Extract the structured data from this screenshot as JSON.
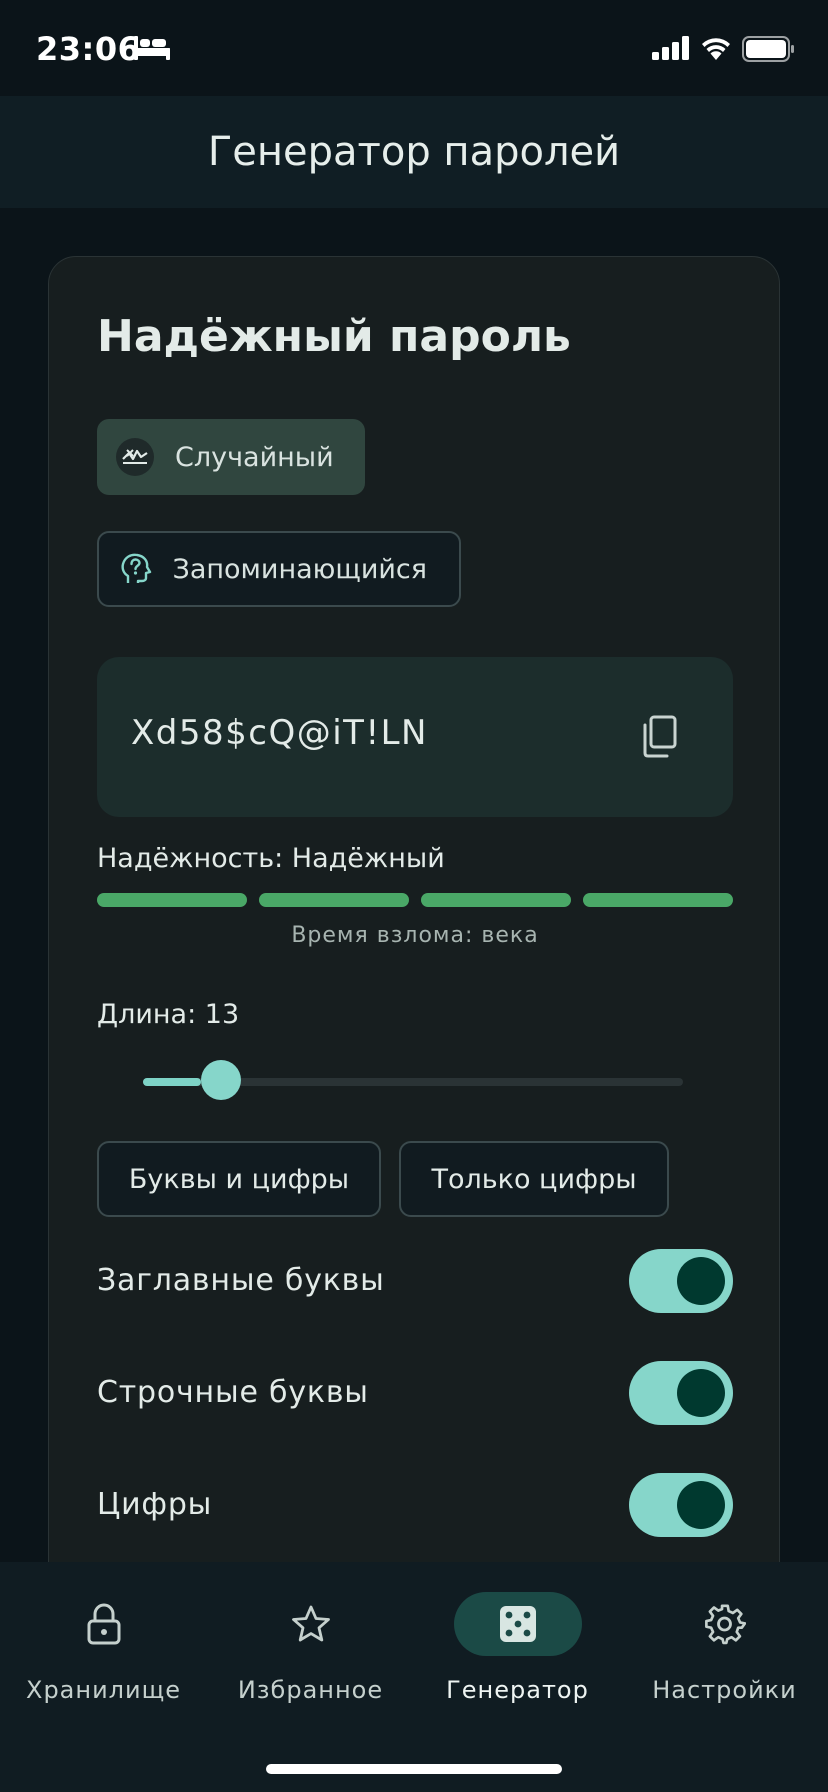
{
  "status_bar": {
    "time": "23:06"
  },
  "header": {
    "title": "Генератор паролей"
  },
  "card": {
    "title": "Надёжный пароль",
    "modes": [
      {
        "label": "Случайный",
        "selected": true
      },
      {
        "label": "Запоминающийся",
        "selected": false
      }
    ],
    "password": "Xd58$cQ@iT!LN",
    "strength": {
      "label": "Надёжность: Надёжный",
      "level": 4,
      "max": 4,
      "crack_time": "Время взлома: века"
    },
    "length": {
      "label": "Длина: 13",
      "value": 13,
      "min": 8,
      "max": 64
    },
    "presets": [
      "Буквы и цифры",
      "Только цифры"
    ],
    "toggles": [
      {
        "label": "Заглавные буквы",
        "on": true
      },
      {
        "label": "Строчные буквы",
        "on": true
      },
      {
        "label": "Цифры",
        "on": true
      }
    ]
  },
  "nav": {
    "items": [
      {
        "label": "Хранилище",
        "icon": "lock-icon",
        "active": false
      },
      {
        "label": "Избранное",
        "icon": "star-icon",
        "active": false
      },
      {
        "label": "Генератор",
        "icon": "dice-icon",
        "active": true
      },
      {
        "label": "Настройки",
        "icon": "gear-icon",
        "active": false
      }
    ]
  },
  "colors": {
    "accent": "#86d6ca",
    "strength_on": "#4aa867",
    "background": "#0b1419",
    "card": "#171e1f"
  }
}
